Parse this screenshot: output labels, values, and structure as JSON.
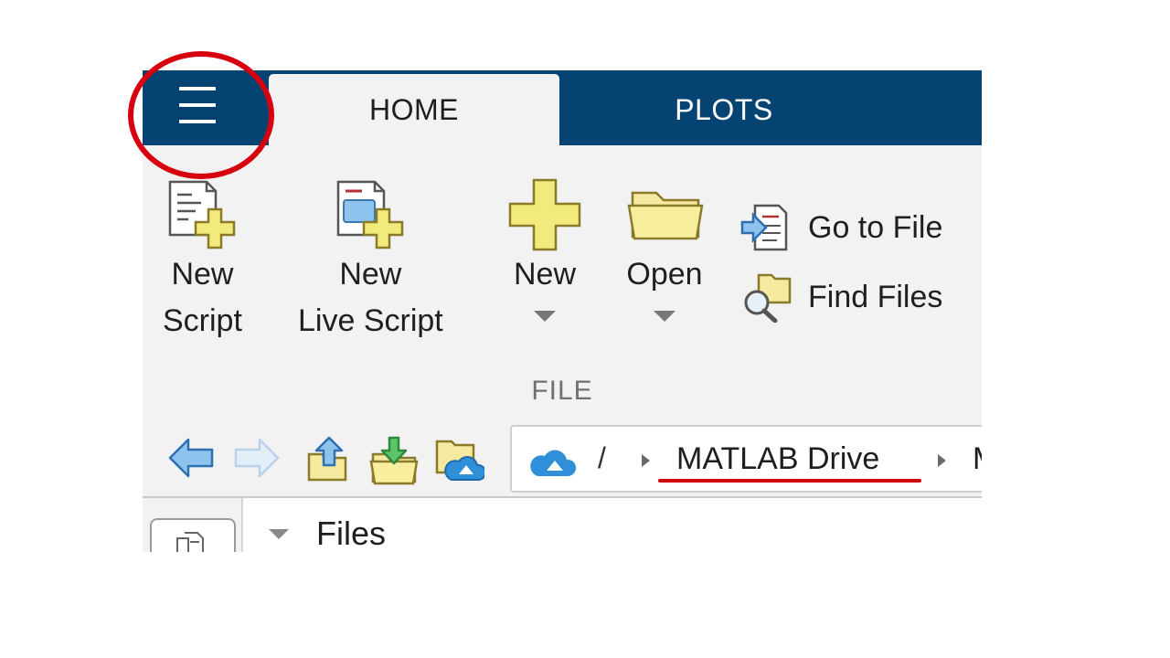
{
  "tabs": [
    {
      "label": "HOME",
      "active": true
    },
    {
      "label": "PLOTS",
      "active": false
    }
  ],
  "file_tools": {
    "new_script": {
      "line1": "New",
      "line2": "Script"
    },
    "new_live_script": {
      "line1": "New",
      "line2": "Live Script"
    },
    "new": {
      "label": "New"
    },
    "open": {
      "label": "Open"
    },
    "go_to_file": {
      "label": "Go to File"
    },
    "find_files": {
      "label": "Find Files"
    },
    "group_label": "FILE"
  },
  "address_bar": {
    "root": "/",
    "crumbs": [
      "MATLAB Drive",
      "M"
    ]
  },
  "files_panel": {
    "title": "Files"
  },
  "colors": {
    "tab_bar": "#054372",
    "toolstrip": "#f2f2f2",
    "annotation_red": "#d7000f",
    "icon_yellow": "#f3ea7d",
    "icon_blue": "#2f8fd8"
  }
}
